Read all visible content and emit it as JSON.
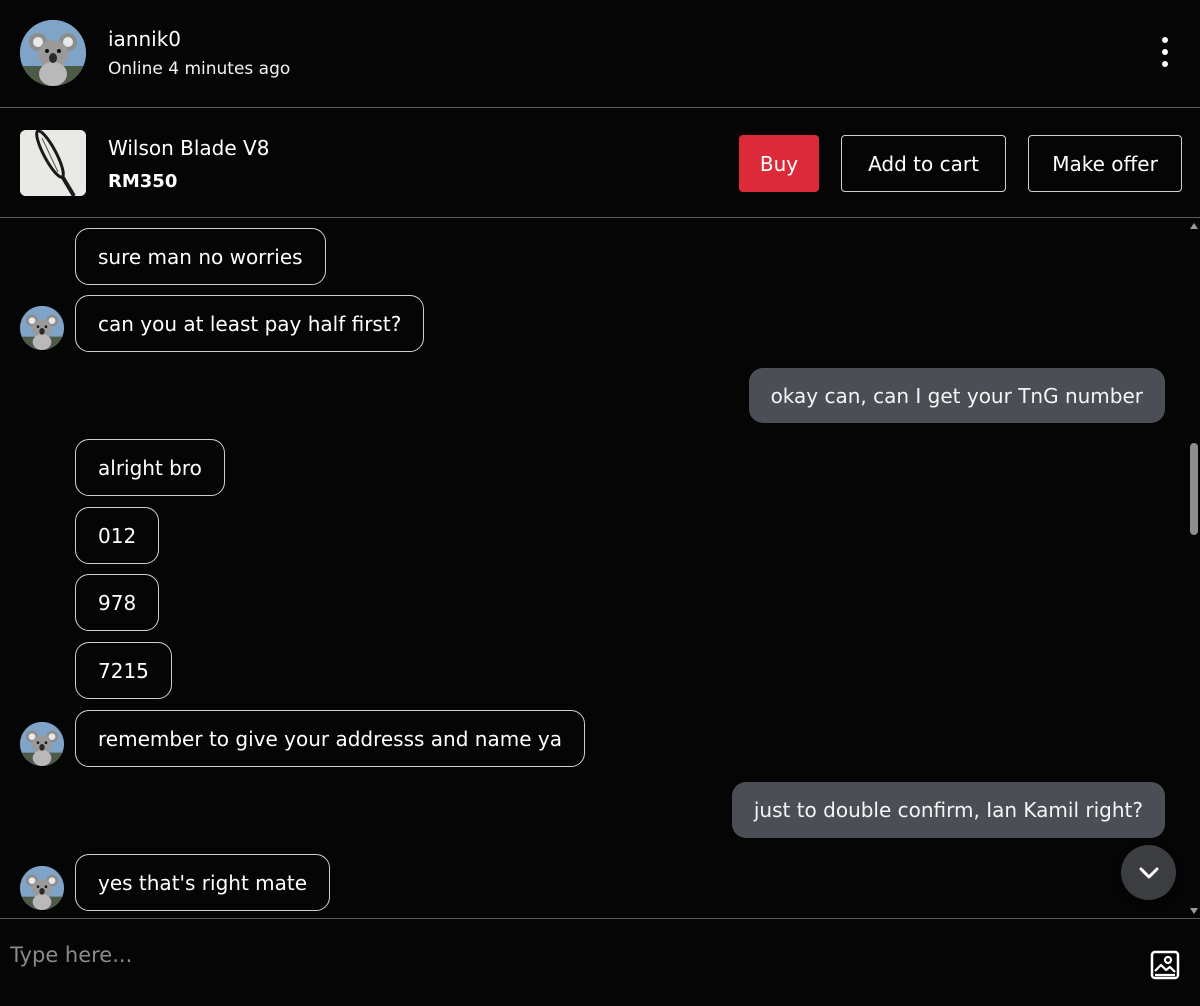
{
  "header": {
    "username": "iannik0",
    "status": "Online 4 minutes ago",
    "more_icon": "more-vertical-icon"
  },
  "product": {
    "name": "Wilson Blade V8",
    "price": "RM350",
    "buy_label": "Buy",
    "cart_label": "Add to cart",
    "offer_label": "Make offer"
  },
  "messages": [
    {
      "from": "other",
      "text": "sure man no worries"
    },
    {
      "from": "other",
      "text": "can you at least pay half first?"
    },
    {
      "from": "me",
      "text": "okay can, can I get your TnG number"
    },
    {
      "from": "other",
      "text": "alright bro"
    },
    {
      "from": "other",
      "text": "012"
    },
    {
      "from": "other",
      "text": "978"
    },
    {
      "from": "other",
      "text": "7215"
    },
    {
      "from": "other",
      "text": "remember to give your addresss and name ya"
    },
    {
      "from": "me",
      "text": "just to double confirm, Ian Kamil right?"
    },
    {
      "from": "other",
      "text": "yes that's right mate"
    }
  ],
  "composer": {
    "placeholder": "Type here...",
    "image_icon": "image-upload-icon"
  },
  "colors": {
    "background": "#050505",
    "buy": "#dc2a3a",
    "outgoing_bubble": "#4b4f55",
    "divider": "#5a5a5a"
  }
}
